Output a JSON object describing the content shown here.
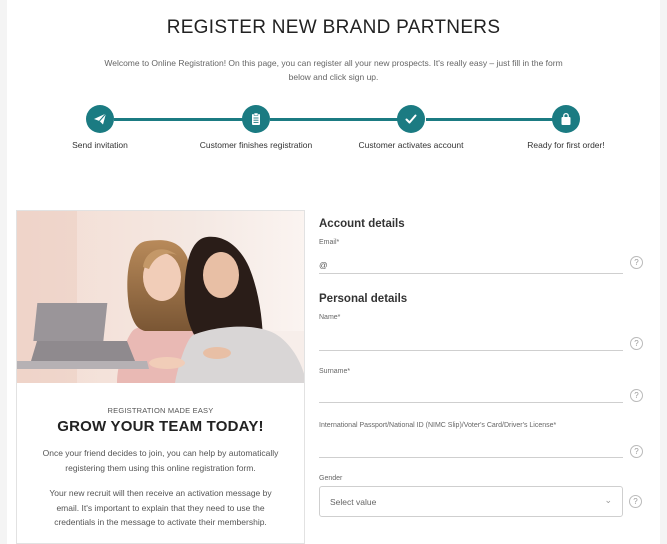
{
  "header": {
    "title": "REGISTER NEW BRAND PARTNERS",
    "intro": "Welcome to Online Registration! On this page, you can register all your new prospects. It's really easy – just fill in the form below and click sign up."
  },
  "steps": [
    {
      "label": "Send invitation",
      "icon": "paper-plane-icon"
    },
    {
      "label": "Customer finishes registration",
      "icon": "clipboard-icon"
    },
    {
      "label": "Customer activates account",
      "icon": "checkmark-icon"
    },
    {
      "label": "Ready for first order!",
      "icon": "shopping-bag-icon"
    }
  ],
  "promo": {
    "kicker": "REGISTRATION MADE EASY",
    "heading": "GROW YOUR TEAM TODAY!",
    "paragraph1": "Once your friend decides to join, you can help by automatically registering them using this online registration form.",
    "paragraph2": "Your new recruit will then receive an activation message by email. It's important to explain that they need to use the credentials in the message to activate their membership."
  },
  "form": {
    "account_title": "Account details",
    "email_label": "Email*",
    "email_prefix": "@",
    "personal_title": "Personal details",
    "name_label": "Name*",
    "surname_label": "Surname*",
    "id_label": "International Passport/National ID (NIMC Slip)/Voter's Card/Driver's License*",
    "gender_label": "Gender",
    "gender_value": "Select value",
    "help_glyph": "?"
  },
  "colors": {
    "accent": "#1b7b82",
    "background": "#f4f4f4"
  }
}
